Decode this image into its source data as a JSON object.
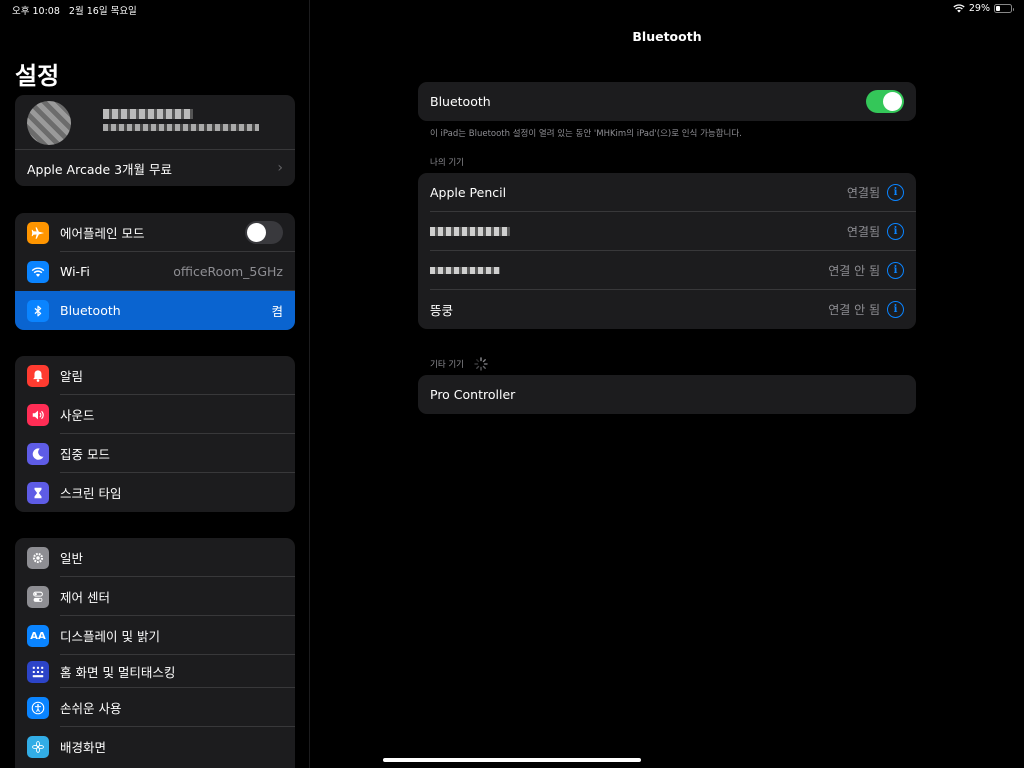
{
  "status": {
    "time": "오후 10:08",
    "date": "2월 16일 목요일",
    "battery": "29%",
    "battery_level": 0.29
  },
  "sidebar": {
    "title": "설정",
    "arcade": "Apple Arcade 3개월 무료",
    "connectivity": [
      {
        "label": "에어플레인 모드",
        "icon": "airplane-icon",
        "color": "#ff9500",
        "toggle": false
      },
      {
        "label": "Wi-Fi",
        "value": "officeRoom_5GHz",
        "icon": "wifi-icon",
        "color": "#0a84ff"
      },
      {
        "label": "Bluetooth",
        "value": "켬",
        "icon": "bluetooth-icon",
        "color": "#0a84ff",
        "selected": true
      }
    ],
    "notifications": [
      {
        "label": "알림",
        "icon": "bell-icon",
        "color": "#ff3b30"
      },
      {
        "label": "사운드",
        "icon": "speaker-icon",
        "color": "#ff2d55"
      },
      {
        "label": "집중 모드",
        "icon": "moon-icon",
        "color": "#5e5ce6"
      },
      {
        "label": "스크린 타임",
        "icon": "hourglass-icon",
        "color": "#5e5ce6"
      }
    ],
    "general": [
      {
        "label": "일반",
        "icon": "gear-icon",
        "color": "#8e8e93"
      },
      {
        "label": "제어 센터",
        "icon": "switches-icon",
        "color": "#8e8e93"
      },
      {
        "label": "디스플레이 및 밝기",
        "icon": "text-size-icon",
        "color": "#0a84ff"
      },
      {
        "label": "홈 화면 및 멀티태스킹",
        "icon": "grid-icon",
        "color": "#2c44c8"
      },
      {
        "label": "손쉬운 사용",
        "icon": "accessibility-icon",
        "color": "#0a84ff"
      },
      {
        "label": "배경화면",
        "icon": "flower-icon",
        "color": "#32ade6"
      }
    ]
  },
  "main": {
    "title": "Bluetooth",
    "bluetooth_label": "Bluetooth",
    "bluetooth_on": true,
    "note": "이 iPad는 Bluetooth 설정이 열려 있는 동안 'MHKim의 iPad'(으)로 인식 가능합니다.",
    "my_devices_label": "나의 기기",
    "my_devices": [
      {
        "name": "Apple Pencil",
        "status": "연결됨"
      },
      {
        "name": "",
        "status": "연결됨",
        "redacted": true
      },
      {
        "name": "",
        "status": "연결 안 됨",
        "redacted": true
      },
      {
        "name": "뜽쿵",
        "status": "연결 안 됨"
      }
    ],
    "other_devices_label": "기타 기기",
    "other_devices": [
      {
        "name": "Pro Controller"
      }
    ]
  }
}
